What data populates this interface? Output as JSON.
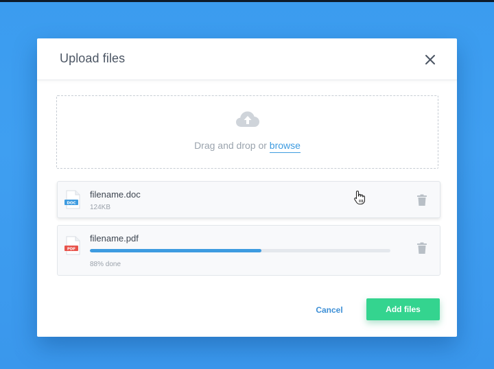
{
  "dialog": {
    "title": "Upload files",
    "close_icon": "close-icon"
  },
  "dropzone": {
    "icon": "cloud-upload-icon",
    "text_prefix": "Drag and drop or ",
    "browse_label": "browse"
  },
  "files": [
    {
      "name": "filename.doc",
      "meta": "124KB",
      "type_badge": "DOC",
      "badge_color": "#3d9be0",
      "icon": "doc-file-icon",
      "delete_icon": "trash-icon",
      "progress": null
    },
    {
      "name": "filename.pdf",
      "meta": "88% done",
      "type_badge": "PDF",
      "badge_color": "#e8534b",
      "icon": "pdf-file-icon",
      "delete_icon": "trash-icon",
      "progress": 0.57
    }
  ],
  "actions": {
    "cancel_label": "Cancel",
    "add_label": "Add files"
  },
  "colors": {
    "background": "#3f9ff1",
    "accent": "#3d9be0",
    "primary_button": "#34d48f",
    "progress_fill": "#3d9be0"
  },
  "cursor": "hand-pointer-icon"
}
